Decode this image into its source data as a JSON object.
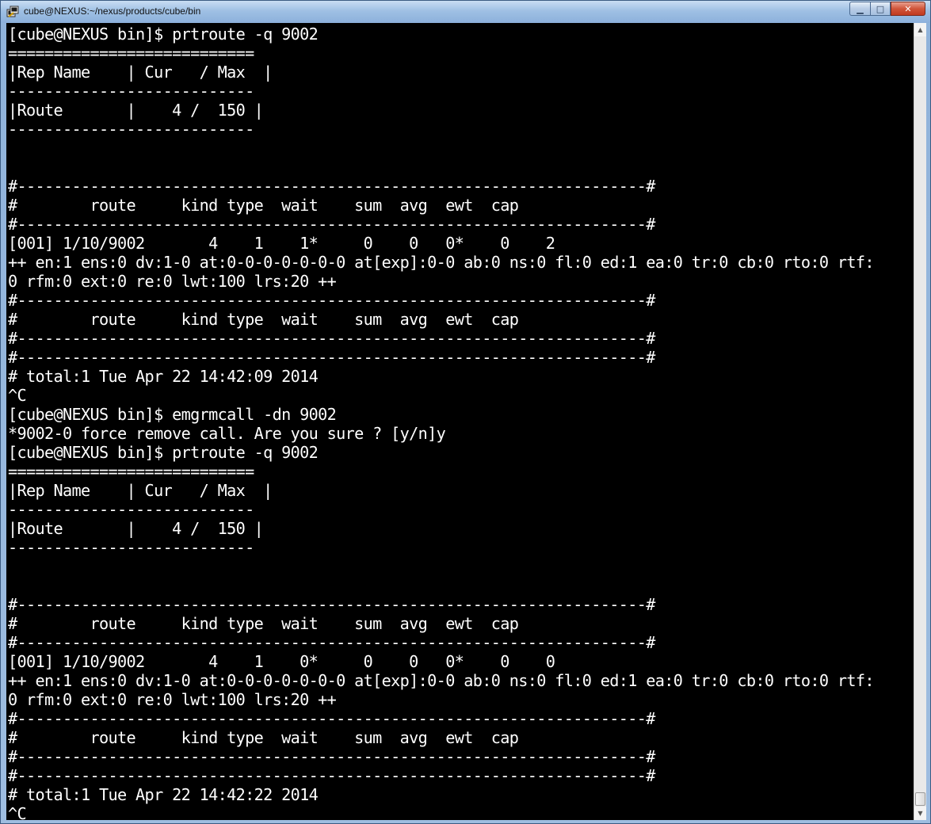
{
  "window": {
    "title": "cube@NEXUS:~/nexus/products/cube/bin",
    "buttons": {
      "minimize": "▁",
      "maximize": "□",
      "close": "✕"
    },
    "icon": "putty-terminal-icon"
  },
  "terminal": {
    "lines": [
      "[cube@NEXUS bin]$ prtroute -q 9002",
      "===========================",
      "|Rep Name    | Cur   / Max  |",
      "---------------------------",
      "|Route       |    4 /  150 |",
      "---------------------------",
      "",
      "",
      "#---------------------------------------------------------------------#",
      "#        route     kind type  wait    sum  avg  ewt  cap",
      "#---------------------------------------------------------------------#",
      "[001] 1/10/9002       4    1    1*     0    0   0*    0    2",
      "++ en:1 ens:0 dv:1-0 at:0-0-0-0-0-0-0 at[exp]:0-0 ab:0 ns:0 fl:0 ed:1 ea:0 tr:0 cb:0 rto:0 rtf:",
      "0 rfm:0 ext:0 re:0 lwt:100 lrs:20 ++",
      "#---------------------------------------------------------------------#",
      "#        route     kind type  wait    sum  avg  ewt  cap",
      "#---------------------------------------------------------------------#",
      "#---------------------------------------------------------------------#",
      "# total:1 Tue Apr 22 14:42:09 2014",
      "^C",
      "[cube@NEXUS bin]$ emgrmcall -dn 9002",
      "*9002-0 force remove call. Are you sure ? [y/n]y",
      "[cube@NEXUS bin]$ prtroute -q 9002",
      "===========================",
      "|Rep Name    | Cur   / Max  |",
      "---------------------------",
      "|Route       |    4 /  150 |",
      "---------------------------",
      "",
      "",
      "#---------------------------------------------------------------------#",
      "#        route     kind type  wait    sum  avg  ewt  cap",
      "#---------------------------------------------------------------------#",
      "[001] 1/10/9002       4    1    0*     0    0   0*    0    0",
      "++ en:1 ens:0 dv:1-0 at:0-0-0-0-0-0-0 at[exp]:0-0 ab:0 ns:0 fl:0 ed:1 ea:0 tr:0 cb:0 rto:0 rtf:",
      "0 rfm:0 ext:0 re:0 lwt:100 lrs:20 ++",
      "#---------------------------------------------------------------------#",
      "#        route     kind type  wait    sum  avg  ewt  cap",
      "#---------------------------------------------------------------------#",
      "#---------------------------------------------------------------------#",
      "# total:1 Tue Apr 22 14:42:22 2014",
      "^C"
    ],
    "prompt": "[cube@NEXUS bin]$ ",
    "cursor_color": "#1bff1b",
    "background": "#000000",
    "foreground": "#ffffff"
  },
  "scrollbar": {
    "up_arrow": "▲",
    "down_arrow": "▼"
  }
}
